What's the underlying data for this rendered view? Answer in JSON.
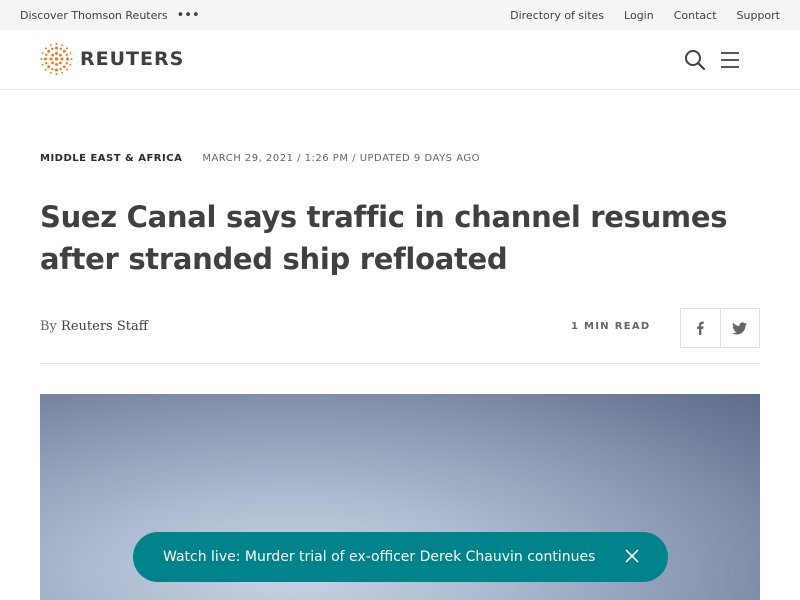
{
  "topbar": {
    "discover": "Discover Thomson Reuters",
    "more_icon": "more-horizontal-icon",
    "links": [
      "Directory of sites",
      "Login",
      "Contact",
      "Support"
    ]
  },
  "header": {
    "logo_text": "REUTERS",
    "search_icon": "search-icon",
    "menu_icon": "hamburger-menu-icon"
  },
  "article": {
    "section": "Middle East & Africa",
    "date": "March 29, 2021 / 1:26 PM / Updated 9 days ago",
    "headline": "Suez Canal says traffic in channel resumes after stranded ship refloated",
    "byline_prefix": "By",
    "author": "Reuters Staff",
    "read_time": "1 Min Read",
    "share_icons": [
      "facebook-icon",
      "twitter-icon"
    ]
  },
  "live_banner": {
    "text": "Watch live: Murder trial of ex-officer Derek Chauvin continues",
    "close_icon": "close-icon"
  },
  "colors": {
    "brand_orange": "#f27522",
    "live_teal": "#00838a",
    "text_dark": "#404040"
  }
}
